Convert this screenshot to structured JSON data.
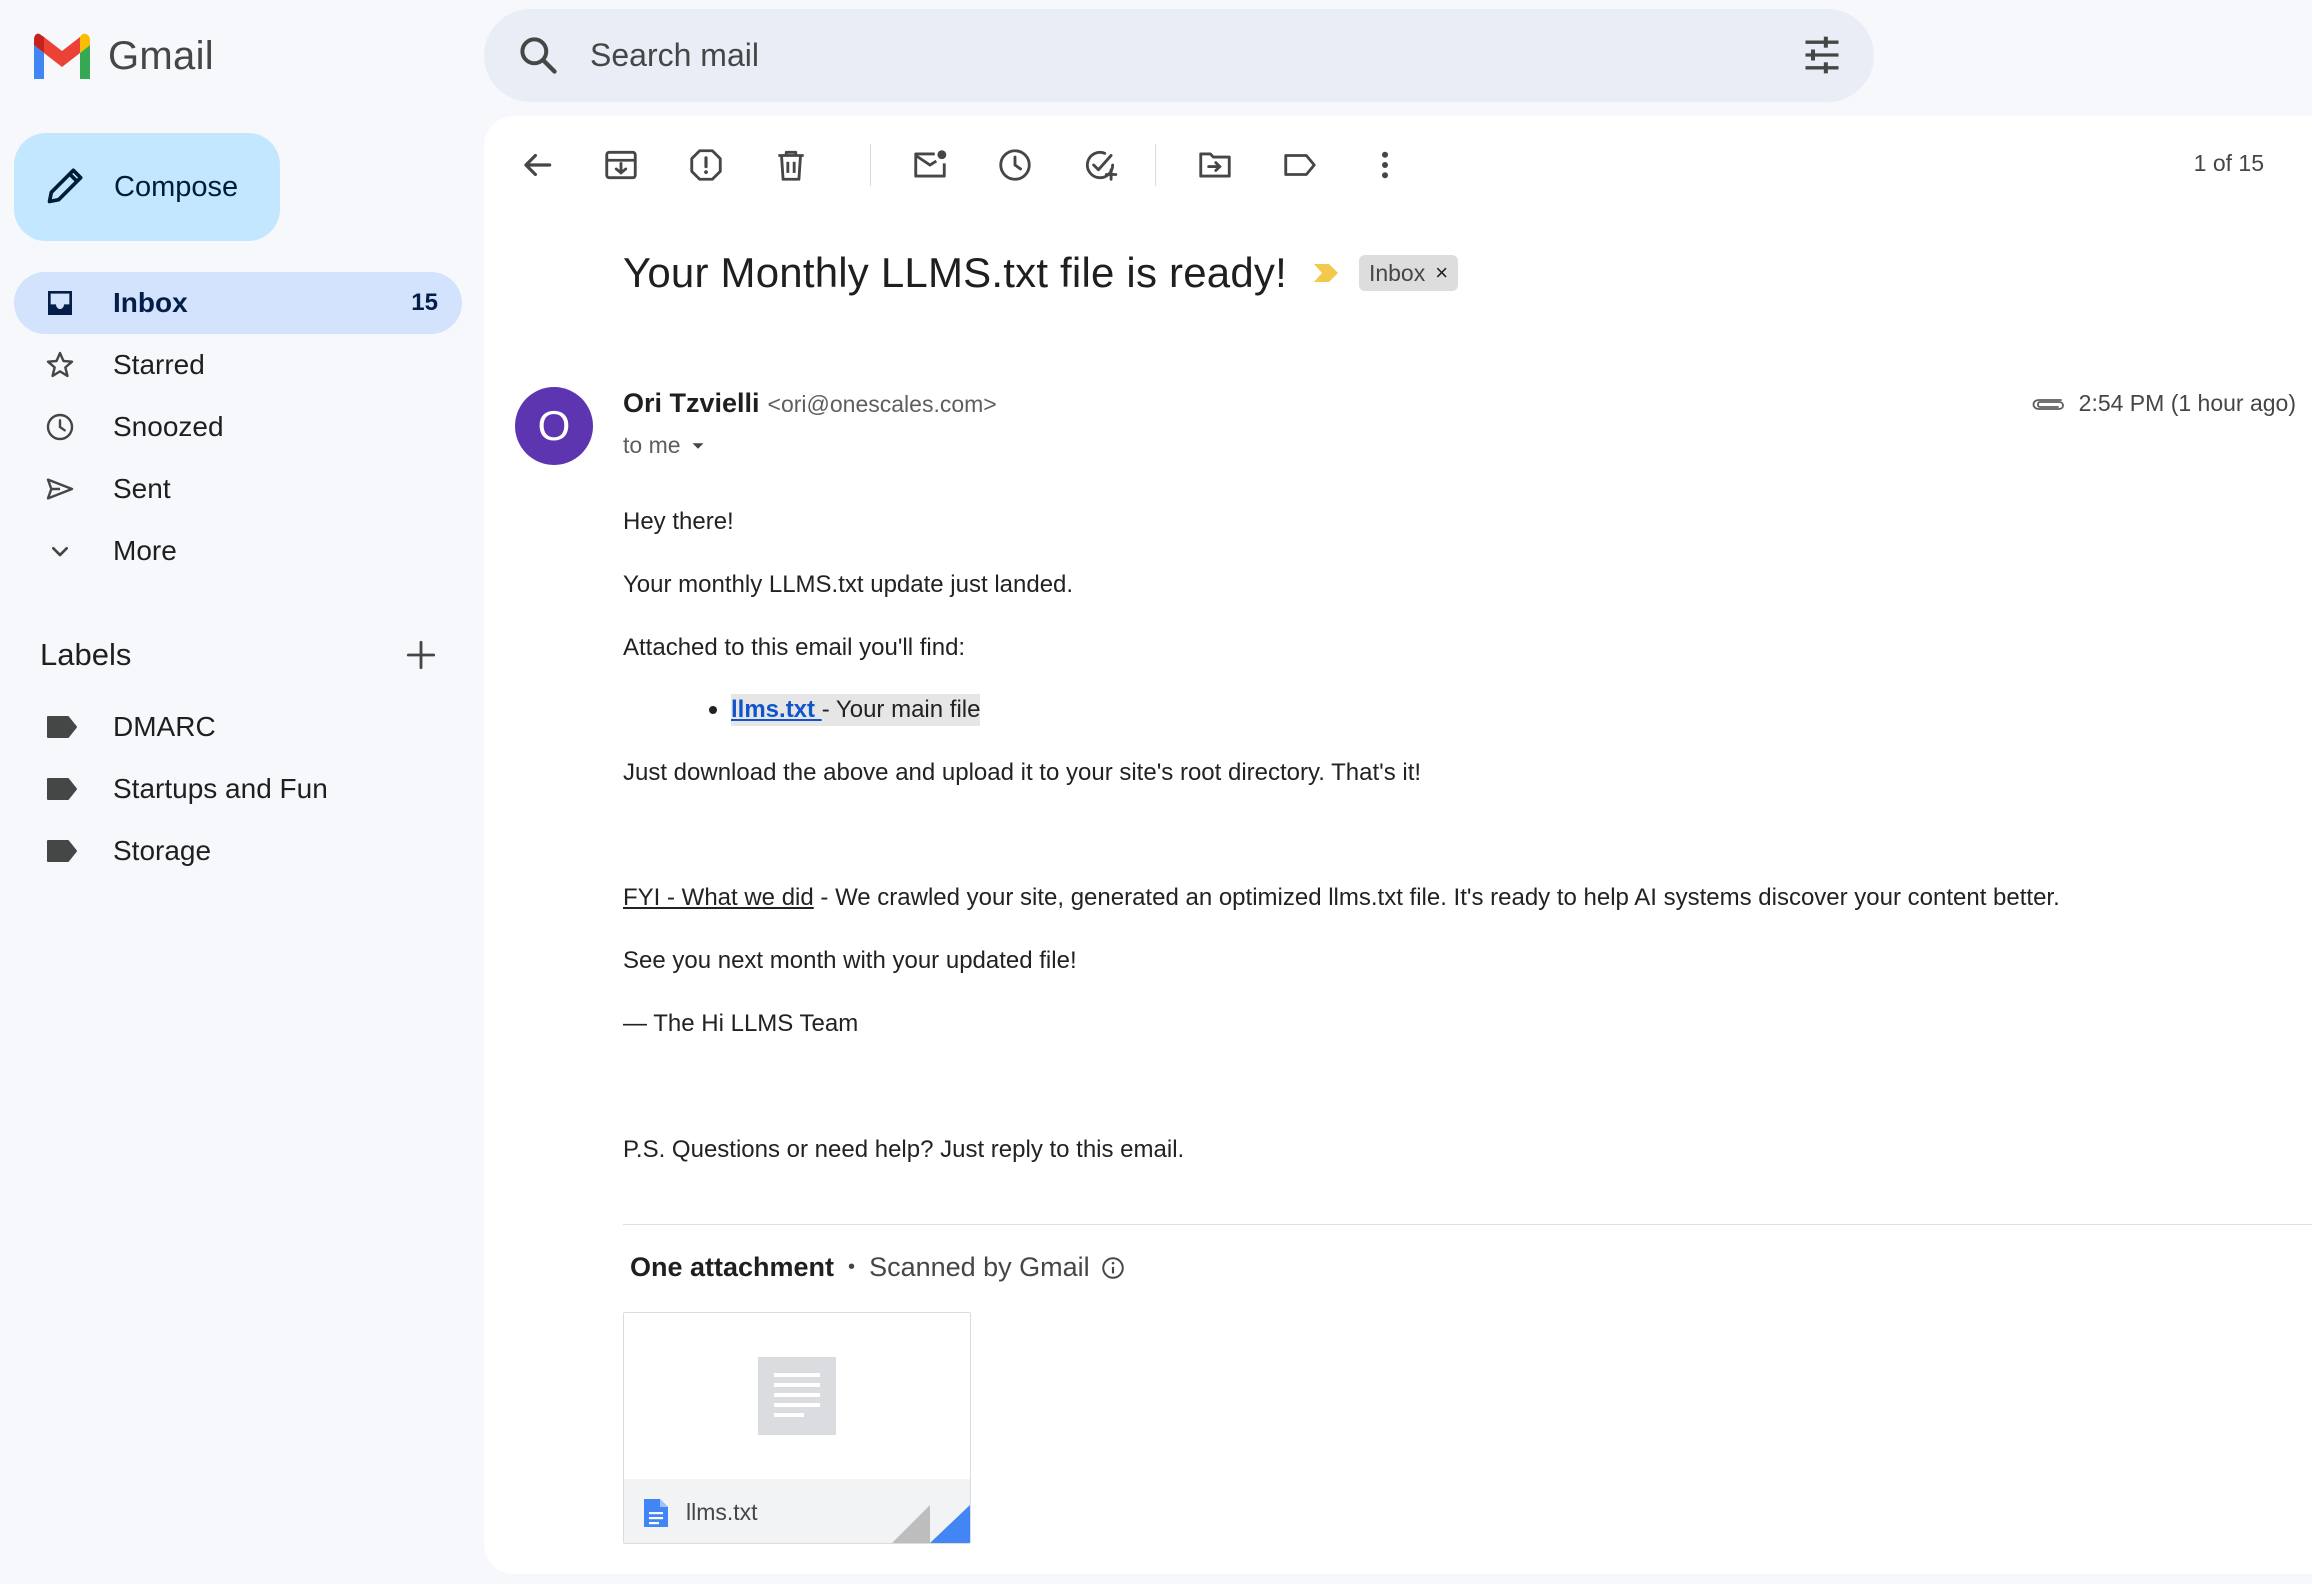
{
  "app": {
    "name": "Gmail"
  },
  "search": {
    "placeholder": "Search mail"
  },
  "compose": {
    "label": "Compose"
  },
  "nav": [
    {
      "label": "Inbox",
      "count": "15",
      "icon": "inbox-icon"
    },
    {
      "label": "Starred",
      "icon": "star-icon"
    },
    {
      "label": "Snoozed",
      "icon": "clock-icon"
    },
    {
      "label": "Sent",
      "icon": "send-icon"
    },
    {
      "label": "More",
      "icon": "chevron-down-icon"
    }
  ],
  "labels": {
    "title": "Labels",
    "items": [
      {
        "label": "DMARC"
      },
      {
        "label": "Startups and Fun"
      },
      {
        "label": "Storage"
      }
    ]
  },
  "toolbar": {
    "pager": "1 of 15",
    "icons": [
      "back-arrow-icon",
      "archive-icon",
      "report-spam-icon",
      "delete-icon",
      "mark-unread-icon",
      "snooze-icon",
      "add-to-tasks-icon",
      "move-to-icon",
      "label-icon",
      "more-vert-icon"
    ]
  },
  "email": {
    "subject": "Your Monthly LLMS.txt file is ready!",
    "chip": "Inbox",
    "avatar_letter": "O",
    "sender_name": "Ori Tzvielli",
    "sender_email": "<ori@onescales.com>",
    "to": "to me",
    "time": "2:54 PM (1 hour ago)",
    "body": {
      "greeting": "Hey there!",
      "line1": "Your monthly LLMS.txt update just landed.",
      "line2": "Attached to this email you'll find:",
      "bullet_link": "llms.txt ",
      "bullet_rest": "- Your main file",
      "line3": "Just download the above and upload it to your site's root directory. That's it!",
      "fyi_label": "FYI - What we did",
      "fyi_rest": " - We crawled your site, generated an optimized llms.txt file. It's ready to help AI systems discover your content better.",
      "line4": "See you next month with your updated file!",
      "signoff": "— The Hi LLMS Team",
      "ps": "P.S. Questions or need help? Just reply to this email."
    }
  },
  "attachments": {
    "title": "One attachment",
    "separator": "•",
    "scanned": "Scanned by Gmail",
    "file_name": "llms.txt"
  },
  "colors": {
    "accent": "#c2e7ff",
    "nav_active": "#d3e3fd",
    "avatar": "#5e35b1",
    "link": "#1155cc",
    "importance": "#f2c94c"
  }
}
